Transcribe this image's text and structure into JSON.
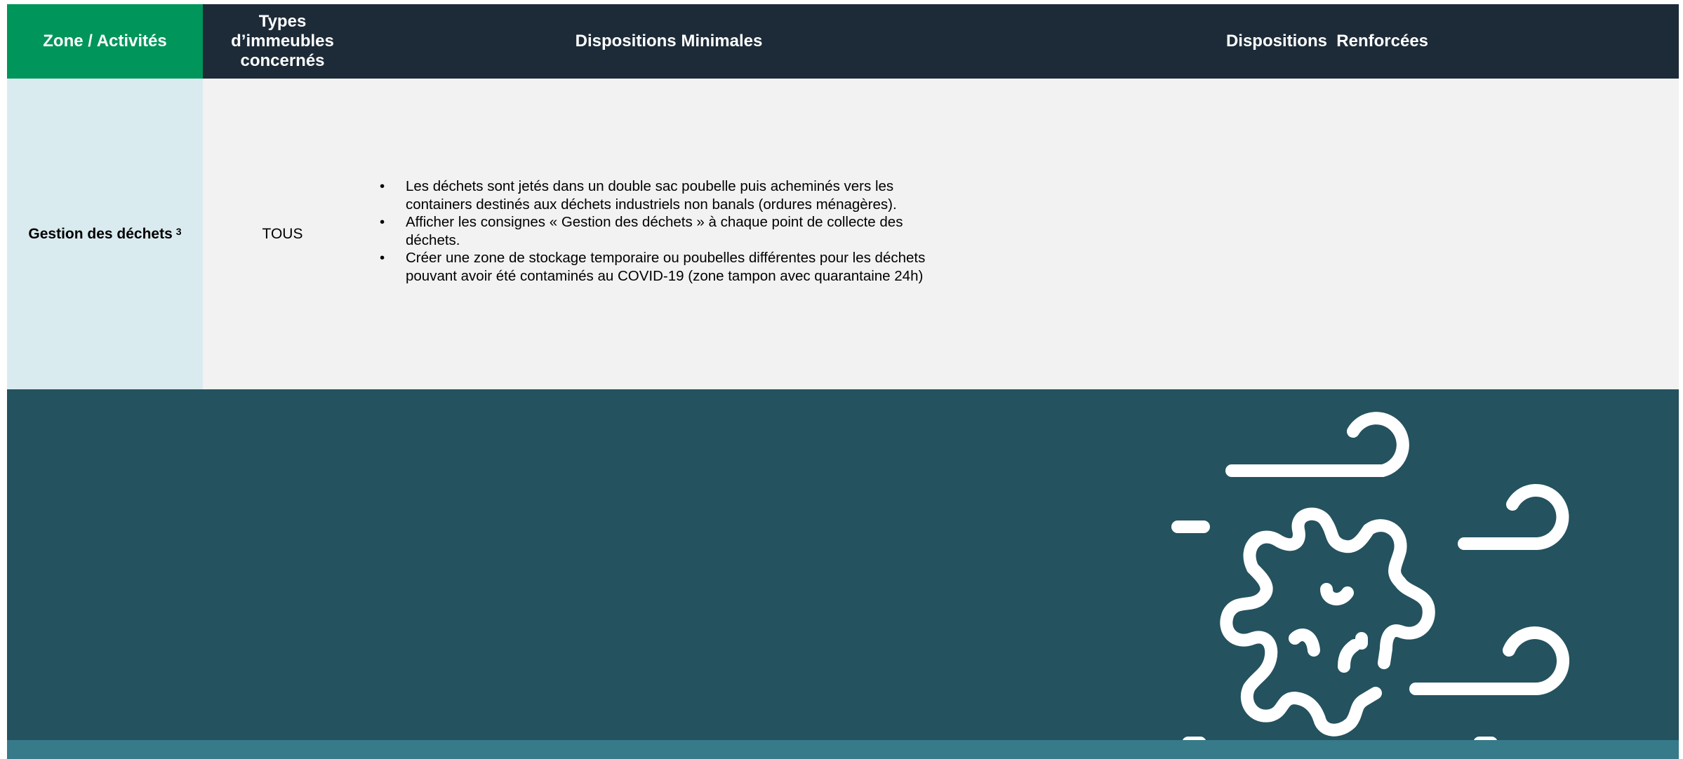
{
  "table": {
    "headers": {
      "zone": "Zone / Activités",
      "types": "Types d’immeubles concernés",
      "minimales": "Dispositions Minimales",
      "renforcees": "Dispositions  Renforcées"
    },
    "row": {
      "zone": "Gestion des déchets",
      "zone_note": "3",
      "types": "TOUS",
      "minimales": [
        "Les déchets sont jetés dans un double sac poubelle puis acheminés vers les containers destinés aux déchets industriels non banals (ordures ménagères).",
        "Afficher les consignes « Gestion des déchets » à chaque point de collecte des déchets.",
        "Créer une zone de stockage temporaire ou poubelles différentes pour les déchets pouvant avoir été contaminés au COVID-19 (zone tampon avec quarantaine 24h)"
      ],
      "renforcees": ""
    }
  },
  "colors": {
    "header_zone": "#00955a",
    "header_dark": "#1d2b38",
    "zone_cell": "#daebf0",
    "body_cell": "#f2f2f2",
    "band": "#24525f",
    "band_strip": "#377a8a"
  },
  "decoration": {
    "icon": "virus-wind-icon"
  }
}
